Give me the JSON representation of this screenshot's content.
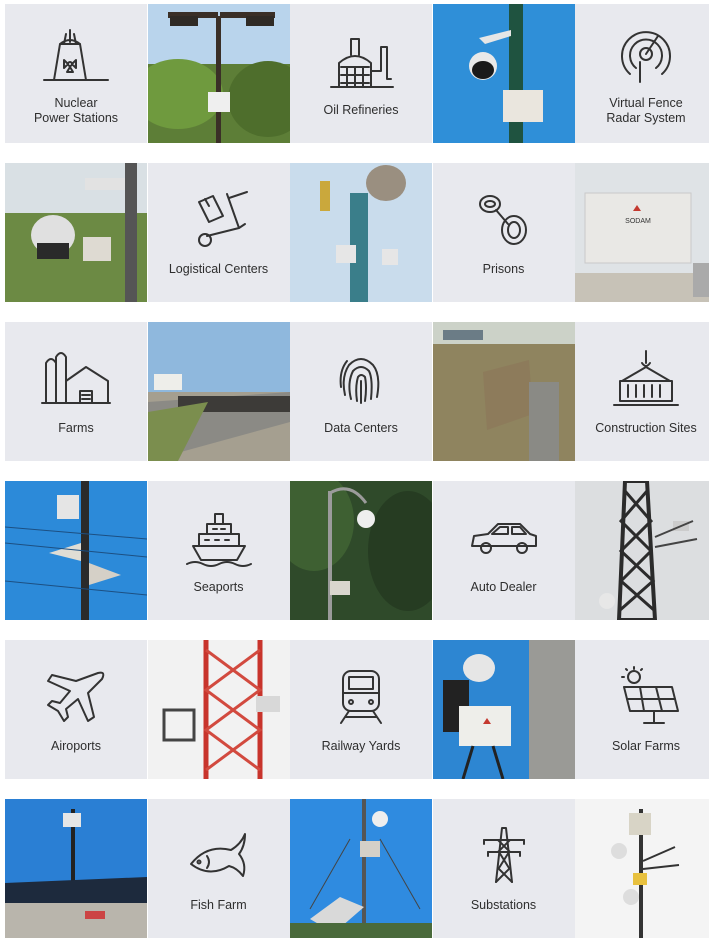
{
  "rows": [
    [
      {
        "type": "icon",
        "icon": "nuclear-plant-icon",
        "label": "Nuclear\nPower Stations"
      },
      {
        "type": "photo",
        "scene": "light-pole-trees"
      },
      {
        "type": "icon",
        "icon": "oil-refinery-icon",
        "label": "Oil Refineries"
      },
      {
        "type": "photo",
        "scene": "camera-pole-blue-sky"
      },
      {
        "type": "icon",
        "icon": "radar-icon",
        "label": "Virtual Fence\nRadar System"
      }
    ],
    [
      {
        "type": "photo",
        "scene": "ptz-camera-field"
      },
      {
        "type": "icon",
        "icon": "hand-truck-icon",
        "label": "Logistical Centers"
      },
      {
        "type": "photo",
        "scene": "mast-satellite-dish"
      },
      {
        "type": "icon",
        "icon": "handcuffs-icon",
        "label": "Prisons"
      },
      {
        "type": "photo",
        "scene": "radar-unit-closeup",
        "brand": "SODAM"
      }
    ],
    [
      {
        "type": "icon",
        "icon": "farm-silo-icon",
        "label": "Farms"
      },
      {
        "type": "photo",
        "scene": "railway-radar"
      },
      {
        "type": "icon",
        "icon": "fingerprint-icon",
        "label": "Data Centers"
      },
      {
        "type": "photo",
        "scene": "radar-on-post"
      },
      {
        "type": "icon",
        "icon": "crane-container-icon",
        "label": "Construction Sites"
      }
    ],
    [
      {
        "type": "photo",
        "scene": "speaker-mast"
      },
      {
        "type": "icon",
        "icon": "ship-icon",
        "label": "Seaports"
      },
      {
        "type": "photo",
        "scene": "camera-pole-trees"
      },
      {
        "type": "icon",
        "icon": "car-icon",
        "label": "Auto Dealer"
      },
      {
        "type": "photo",
        "scene": "lattice-tower"
      }
    ],
    [
      {
        "type": "icon",
        "icon": "airplane-icon",
        "label": "Airoports"
      },
      {
        "type": "photo",
        "scene": "red-white-tower"
      },
      {
        "type": "icon",
        "icon": "train-icon",
        "label": "Railway Yards"
      },
      {
        "type": "photo",
        "scene": "camera-radar-mast"
      },
      {
        "type": "icon",
        "icon": "solar-panel-icon",
        "label": "Solar Farms"
      }
    ],
    [
      {
        "type": "photo",
        "scene": "solar-trailer"
      },
      {
        "type": "icon",
        "icon": "fish-icon",
        "label": "Fish Farm"
      },
      {
        "type": "photo",
        "scene": "solar-mast"
      },
      {
        "type": "icon",
        "icon": "power-pylon-icon",
        "label": "Substations"
      },
      {
        "type": "photo",
        "scene": "mast-white-sky"
      }
    ]
  ]
}
